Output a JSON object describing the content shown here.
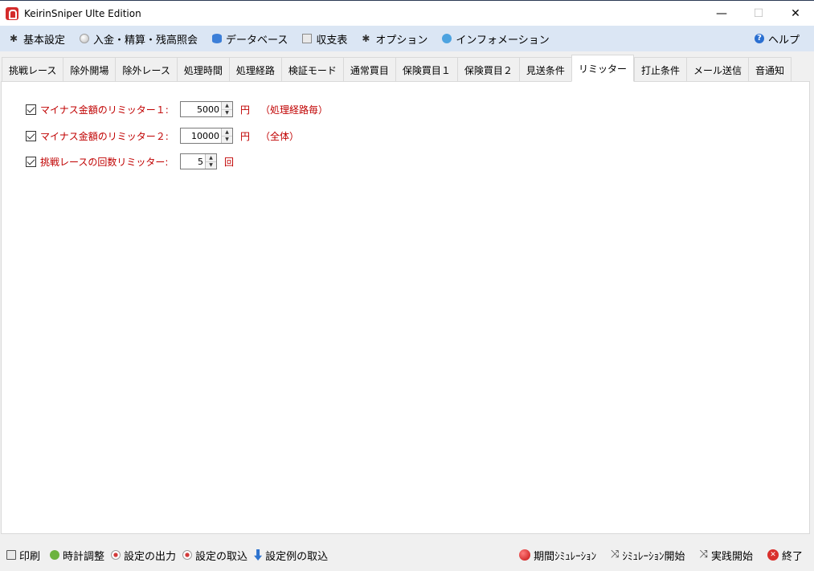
{
  "window": {
    "title": "KeirinSniper Ulte Edition",
    "minimize": "—",
    "maximize": "☐",
    "close": "✕"
  },
  "menu": [
    {
      "label": "基本設定",
      "icon": "gear-icon"
    },
    {
      "label": "入金・精算・残高照会",
      "icon": "coin-icon"
    },
    {
      "label": "データベース",
      "icon": "database-icon"
    },
    {
      "label": "収支表",
      "icon": "document-icon"
    },
    {
      "label": "オプション",
      "icon": "gear-icon"
    },
    {
      "label": "インフォメーション",
      "icon": "chat-icon"
    }
  ],
  "help": {
    "label": "ヘルプ",
    "icon": "help-icon"
  },
  "tabs": [
    {
      "label": "挑戦レース"
    },
    {
      "label": "除外開場"
    },
    {
      "label": "除外レース"
    },
    {
      "label": "処理時間"
    },
    {
      "label": "処理経路"
    },
    {
      "label": "検証モード"
    },
    {
      "label": "通常買目"
    },
    {
      "label": "保険買目１"
    },
    {
      "label": "保険買目２"
    },
    {
      "label": "見送条件"
    },
    {
      "label": "リミッター",
      "active": true
    },
    {
      "label": "打止条件"
    },
    {
      "label": "メール送信"
    },
    {
      "label": "音通知"
    }
  ],
  "limiter": {
    "row1": {
      "label": "マイナス金額のリミッター１:",
      "value": "5000",
      "unit": "円",
      "note": "（処理経路毎）",
      "checked": true
    },
    "row2": {
      "label": "マイナス金額のリミッター２:",
      "value": "10000",
      "unit": "円",
      "note": "（全体）",
      "checked": true
    },
    "row3": {
      "label": "挑戦レースの回数リミッター:",
      "value": "5",
      "unit": "回",
      "checked": true
    }
  },
  "bottom_left": [
    {
      "label": "印刷",
      "icon": "printer-icon"
    },
    {
      "label": "時計調整",
      "icon": "clock-icon"
    },
    {
      "label": "設定の出力",
      "icon": "record-icon"
    },
    {
      "label": "設定の取込",
      "icon": "record-icon"
    },
    {
      "label": "設定例の取込",
      "icon": "download-arrow-icon"
    }
  ],
  "bottom_right": [
    {
      "label": "期間ｼﾐｭﾚｰｼｮﾝ",
      "icon": "red-ball-icon"
    },
    {
      "label": "ｼﾐｭﾚｰｼｮﾝ開始",
      "icon": "shuffle-icon"
    },
    {
      "label": "実践開始",
      "icon": "shuffle-icon"
    },
    {
      "label": "終了",
      "icon": "close-circle-icon"
    }
  ],
  "colors": {
    "accent_red": "#c00000",
    "menubar_bg": "#dbe6f4"
  }
}
